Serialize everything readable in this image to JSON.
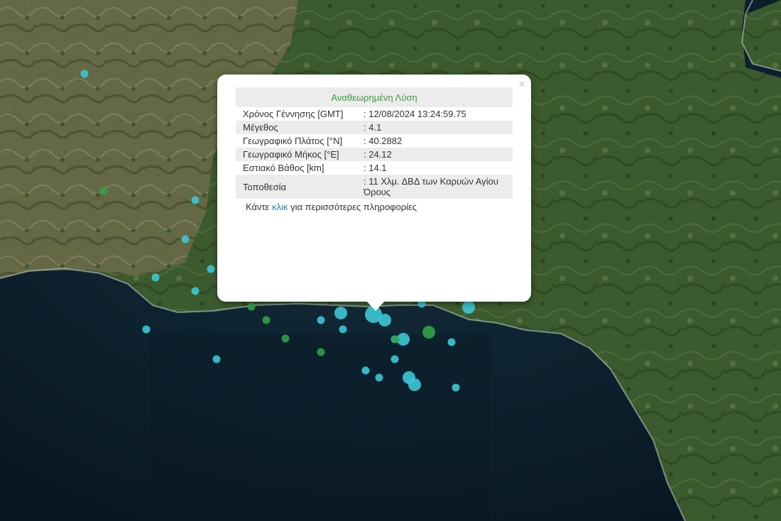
{
  "popup": {
    "title": "Αναθεωρημένη Λύση",
    "close": "×",
    "rows": [
      {
        "label": "Χρόνος Γέννησης [GMT]",
        "value": ": 12/08/2024 13:24:59.75"
      },
      {
        "label": "Μέγεθος",
        "value": ": 4.1"
      },
      {
        "label": "Γεωγραφικό Πλάτος [°N]",
        "value": ": 40.2882"
      },
      {
        "label": "Γεωγραφικό Μήκος [°E]",
        "value": ": 24.12"
      },
      {
        "label": "Εστιακό Βάθος [km]",
        "value": ": 14.1"
      },
      {
        "label": "Τοποθεσία",
        "value": ": 11 Χλμ. ΔΒΔ των Καρυών Αγίου Όρους"
      }
    ],
    "footer_before": "Κάντε ",
    "footer_link": "κλικ",
    "footer_after": " για περισσότερες πληροφορίες"
  },
  "colors": {
    "sea": "#0d2030",
    "land": "#3d5a2e",
    "marker_cyan": "#3cc7d6",
    "marker_green": "#2fa24a",
    "title_green": "#3a9a3a",
    "link_blue": "#2a7ab0"
  },
  "markers": [
    {
      "color": "cyan",
      "magnitude": 1
    },
    {
      "color": "green",
      "magnitude": 1
    },
    {
      "color": "cyan",
      "magnitude": 1
    },
    {
      "color": "cyan",
      "magnitude": 1
    },
    {
      "color": "cyan",
      "magnitude": 1
    },
    {
      "color": "cyan",
      "magnitude": 1
    },
    {
      "color": "cyan",
      "magnitude": 1
    },
    {
      "color": "cyan",
      "magnitude": 1
    },
    {
      "color": "green",
      "magnitude": 1
    },
    {
      "color": "green",
      "magnitude": 1
    },
    {
      "color": "green",
      "magnitude": 1
    },
    {
      "color": "green",
      "magnitude": 1
    },
    {
      "color": "cyan",
      "magnitude": 1
    },
    {
      "color": "cyan",
      "magnitude": 2
    },
    {
      "color": "cyan",
      "magnitude": 1
    },
    {
      "color": "cyan",
      "magnitude": 4.1
    },
    {
      "color": "cyan",
      "magnitude": 2
    },
    {
      "color": "cyan",
      "magnitude": 1
    },
    {
      "color": "cyan",
      "magnitude": 2
    },
    {
      "color": "green",
      "magnitude": 2
    },
    {
      "color": "cyan",
      "magnitude": 1
    },
    {
      "color": "cyan",
      "magnitude": 1
    },
    {
      "color": "cyan",
      "magnitude": 1
    },
    {
      "color": "cyan",
      "magnitude": 1
    },
    {
      "color": "cyan",
      "magnitude": 2
    },
    {
      "color": "cyan",
      "magnitude": 2
    },
    {
      "color": "cyan",
      "magnitude": 1
    },
    {
      "color": "cyan",
      "magnitude": 2
    },
    {
      "color": "cyan",
      "magnitude": 1
    },
    {
      "color": "cyan",
      "magnitude": 1
    },
    {
      "color": "green",
      "magnitude": 1
    }
  ]
}
